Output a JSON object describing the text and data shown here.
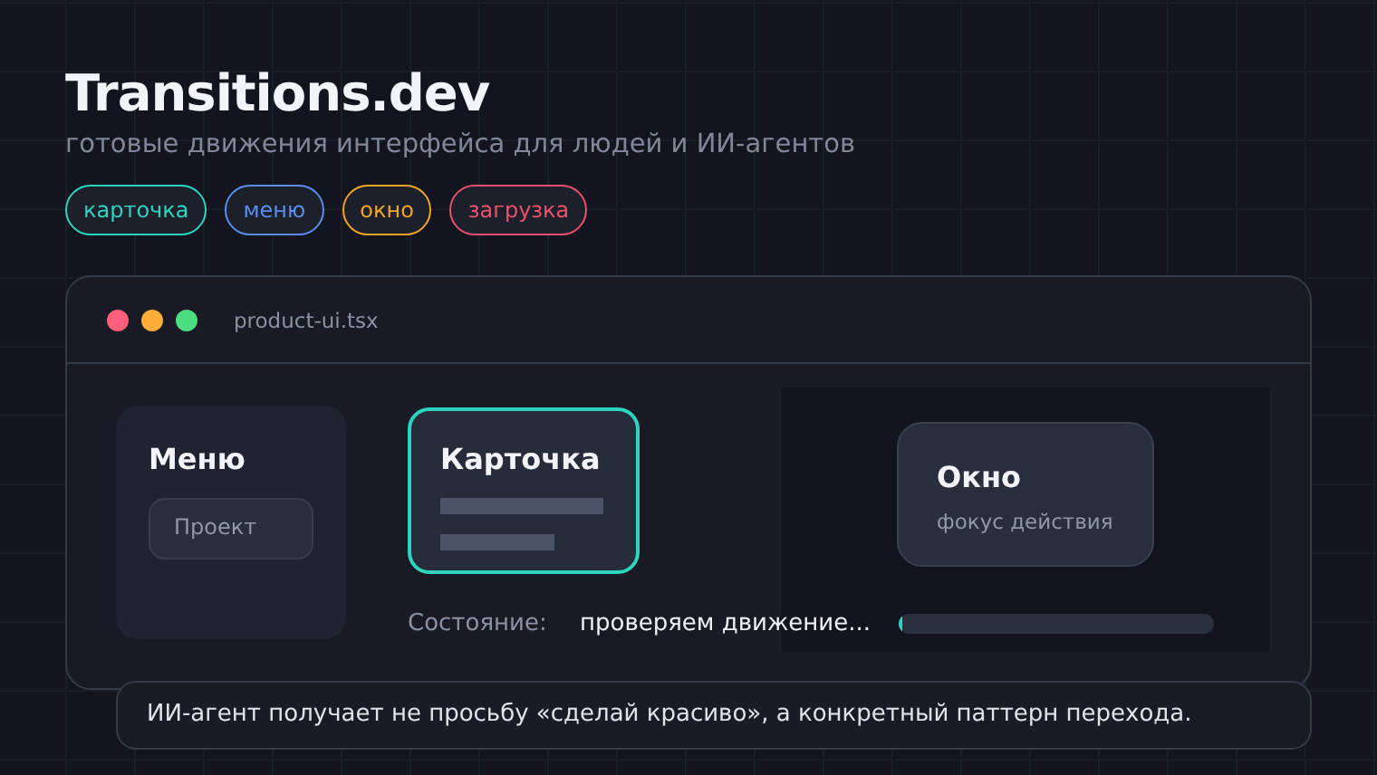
{
  "title": "Transitions.dev",
  "subtitle": "готовые движения интерфейса для людей и ИИ-агентов",
  "tags": [
    {
      "label": "карточка",
      "color": "#2dd4bf"
    },
    {
      "label": "меню",
      "color": "#5b8def"
    },
    {
      "label": "окно",
      "color": "#f5a524"
    },
    {
      "label": "загрузка",
      "color": "#f0506e"
    }
  ],
  "window": {
    "dots": [
      {
        "color": "#ff5f7a"
      },
      {
        "color": "#ffad3b"
      },
      {
        "color": "#4ade80"
      }
    ],
    "filename": "product-ui.tsx",
    "menu": {
      "title": "Меню",
      "item": "Проект"
    },
    "card": {
      "title": "Карточка",
      "selected": true
    },
    "dialog": {
      "title": "Окно",
      "subtitle": "фокус действия"
    },
    "status": {
      "label": "Состояние:",
      "value": "проверяем движение...",
      "level": 0.01
    }
  },
  "caption": "ИИ-агент получает не просьбу «сделай красиво», а конкретный паттерн перехода."
}
